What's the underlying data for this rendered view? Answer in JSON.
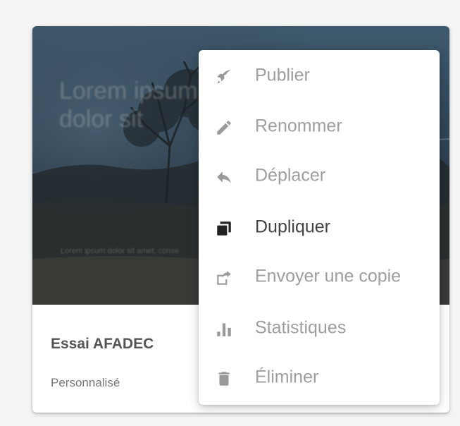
{
  "card": {
    "preview_heading": "Lorem ipsum\ndolor sit",
    "preview_small": "Lorem ipsum dolor sit amet, conse",
    "title": "Essai AFADEC",
    "subtitle": "Personnalisé"
  },
  "menu": {
    "items": [
      {
        "label": "Publier",
        "icon": "rocket-icon",
        "active": false
      },
      {
        "label": "Renommer",
        "icon": "pencil-icon",
        "active": false
      },
      {
        "label": "Déplacer",
        "icon": "reply-arrow-icon",
        "active": false
      },
      {
        "label": "Dupliquer",
        "icon": "duplicate-icon",
        "active": true
      },
      {
        "label": "Envoyer une copie",
        "icon": "send-copy-icon",
        "active": false
      },
      {
        "label": "Statistiques",
        "icon": "bar-chart-icon",
        "active": false
      },
      {
        "label": "Éliminer",
        "icon": "trash-icon",
        "active": false
      }
    ]
  },
  "colors": {
    "menu_text_muted": "#9e9e9e",
    "menu_text_active": "#424242",
    "icon_muted": "#9a9a9a",
    "icon_active": "#222222"
  }
}
